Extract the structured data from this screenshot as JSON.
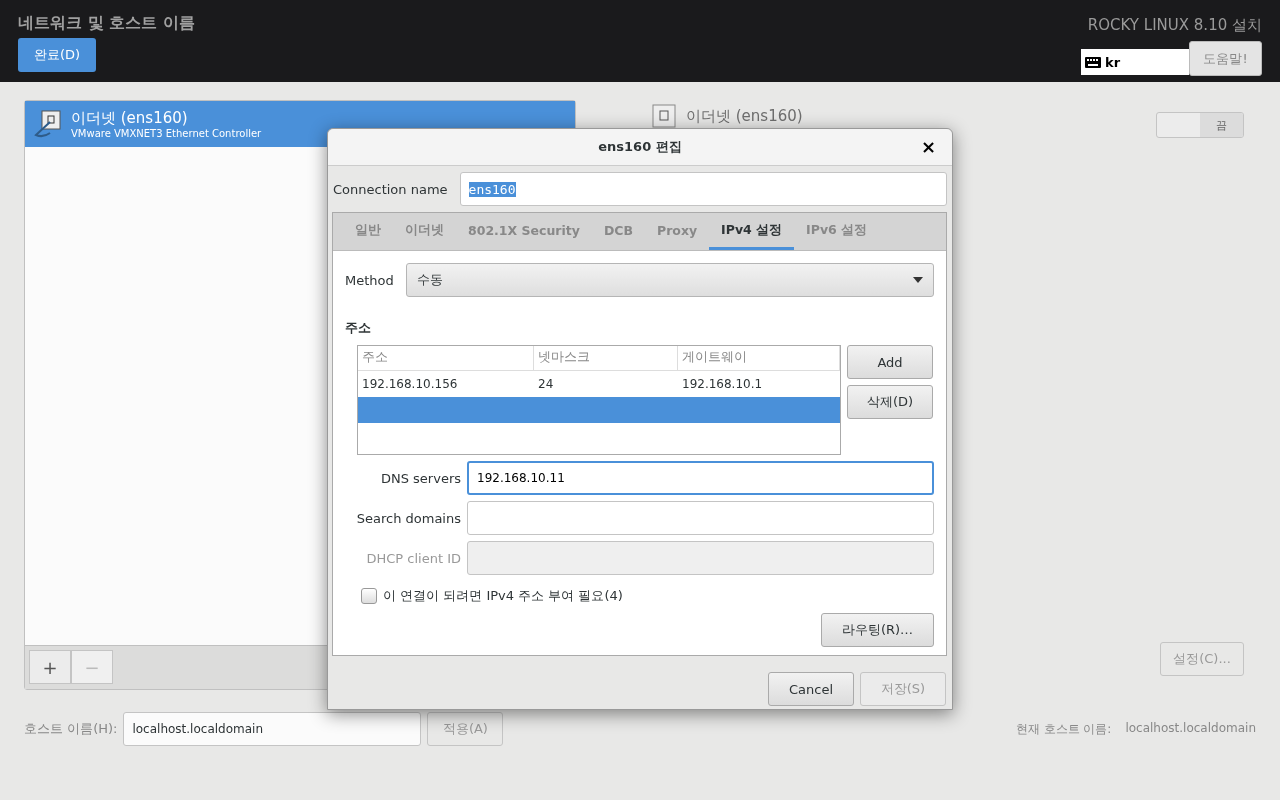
{
  "header": {
    "title": "네트워크 및 호스트 이름",
    "done_button": "완료(D)",
    "product": "ROCKY LINUX 8.10 설치",
    "keyboard_layout": "kr",
    "help_button": "도움말!"
  },
  "devices": {
    "items": [
      {
        "name": "이더넷 (ens160)",
        "description": "VMware VMXNET3 Ethernet Controller",
        "selected": true
      }
    ],
    "add_button": "+",
    "remove_button": "−",
    "remove_disabled": true
  },
  "device_detail": {
    "title": "이더넷 (ens160)",
    "switch": {
      "on": false,
      "label": "끔"
    },
    "configure_button": "설정(C)...",
    "configure_disabled": true
  },
  "hostname": {
    "label": "호스트 이름(H):",
    "value": "localhost.localdomain",
    "apply_button": "적용(A)",
    "apply_disabled": true,
    "current_label": "현재 호스트 이름:",
    "current_value": "localhost.localdomain"
  },
  "dialog": {
    "title": "ens160 편집",
    "close": "×",
    "connection_name_label": "Connection name",
    "connection_name": "ens160",
    "tabs": [
      {
        "label": "일반",
        "selected": false
      },
      {
        "label": "이더넷",
        "selected": false
      },
      {
        "label": "802.1X Security",
        "selected": false
      },
      {
        "label": "DCB",
        "selected": false
      },
      {
        "label": "Proxy",
        "selected": false
      },
      {
        "label": "IPv4 설정",
        "selected": true
      },
      {
        "label": "IPv6 설정",
        "selected": false
      }
    ],
    "method_label": "Method",
    "method": "수동",
    "addresses_heading": "주소",
    "address_columns": [
      "주소",
      "넷마스크",
      "게이트웨이"
    ],
    "address_rows": [
      {
        "cells": [
          "192.168.10.156",
          "24",
          "192.168.10.1"
        ],
        "selected": false
      },
      {
        "cells": [],
        "selected": true
      }
    ],
    "add_button": "Add",
    "delete_button": "삭제(D)",
    "fields": [
      {
        "label": "DNS servers",
        "value": "192.168.10.11",
        "focused": true,
        "disabled": false
      },
      {
        "label": "Search domains",
        "focused": false,
        "disabled": false
      },
      {
        "label": "DHCP client ID",
        "focused": false,
        "disabled": true
      }
    ],
    "require_ipv4": {
      "label": "이 연결이 되려면 IPv4 주소 부여 필요(4)",
      "checked": false
    },
    "routes_button": "라우팅(R)…",
    "cancel_button": "Cancel",
    "save_button": "저장(S)",
    "save_disabled": true
  }
}
